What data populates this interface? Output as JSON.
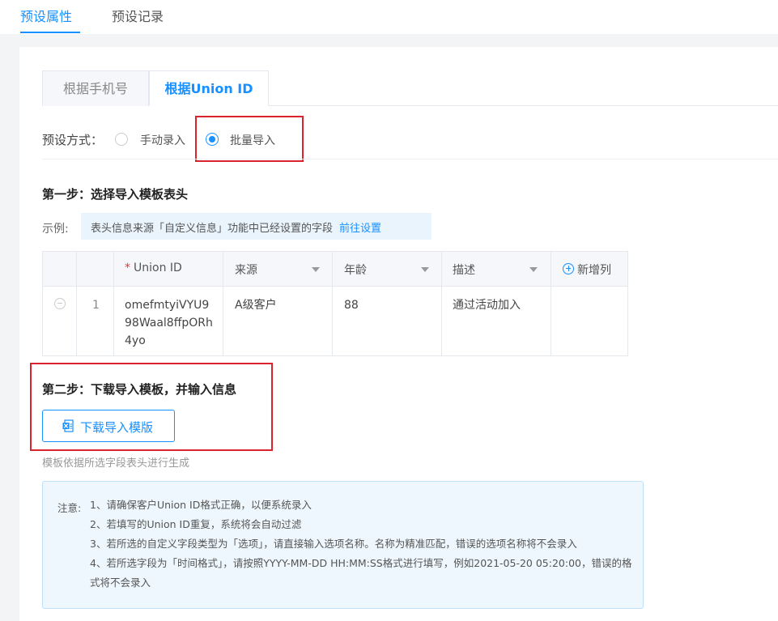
{
  "top_tabs": {
    "attributes": "预设属性",
    "records": "预设记录"
  },
  "sub_tabs": {
    "phone": "根据手机号",
    "union_id": "根据Union ID"
  },
  "mode": {
    "label": "预设方式：",
    "manual": "手动录入",
    "batch": "批量导入",
    "selected": "批量导入"
  },
  "step1": {
    "title": "第一步：选择导入模板表头",
    "example_label": "示例:",
    "example_text": "表头信息来源「自定义信息」功能中已经设置的字段",
    "example_link": "前往设置"
  },
  "table": {
    "columns": {
      "union_id_required": "*",
      "union_id": "Union ID",
      "source": "来源",
      "age": "年龄",
      "description": "描述",
      "add_column": "新增列"
    },
    "row": {
      "index": "1",
      "union_id": "omefmtyiVYU998Waal8ffpORh4yo",
      "source": "A级客户",
      "age": "88",
      "description": "通过活动加入"
    }
  },
  "step2": {
    "title": "第二步：下载导入模板，并输入信息",
    "download_button": "下载导入模版",
    "hint": "模板依据所选字段表头进行生成"
  },
  "notice": {
    "label": "注意:",
    "items": [
      "1、请确保客户Union ID格式正确，以便系统录入",
      "2、若填写的Union ID重复，系统将会自动过滤",
      "3、若所选的自定义字段类型为「选项」，请直接输入选项名称。名称为精准匹配，错误的选项名称将不会录入",
      "4、若所选字段为「时间格式」，请按照YYYY-MM-DD HH:MM:SS格式进行填写，例如2021-05-20 05:20:00，错误的格式将不会录入"
    ]
  },
  "colors": {
    "primary": "#1890ff",
    "highlight_box": "#d9232d",
    "required": "#e53935"
  }
}
